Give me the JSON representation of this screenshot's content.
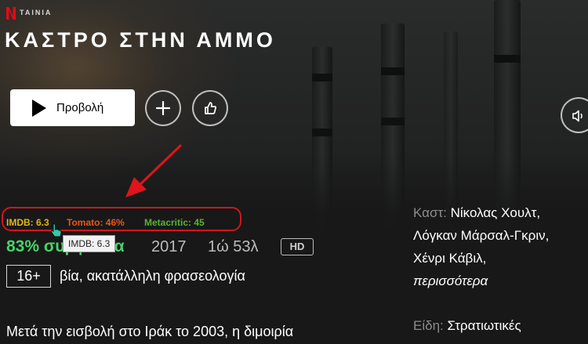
{
  "header": {
    "type_label": "ΤΑΙΝΙΑ",
    "title": "ΚΑΣΤΡΟ ΣΤΗΝ ΑΜΜΟ"
  },
  "actions": {
    "play_label": "Προβολή"
  },
  "ratings": {
    "imdb": "IMDB: 6.3",
    "tomato": "Tomato: 46%",
    "metacritic": "Metacritic: 45",
    "tooltip": "IMDB: 6.3"
  },
  "info": {
    "match": "83% συμφωνία",
    "year": "2017",
    "duration": "1ώ 53λ",
    "quality": "HD",
    "age": "16+",
    "advisory": "βία, ακατάλληλη φρασεολογία",
    "synopsis": "Μετά την εισβολή στο Ιράκ το 2003, η διμοιρία"
  },
  "details": {
    "cast_label": "Καστ:",
    "cast_line1": "Νίκολας Χουλτ,",
    "cast_line2": "Λόγκαν Μάρσαλ-Γκριν,",
    "cast_line3": "Χένρι Κάβιλ,",
    "cast_more": "περισσότερα",
    "genres_label": "Είδη:",
    "genres_line1": "Στρατιωτικές"
  },
  "colors": {
    "netflix_red": "#e50914",
    "annotation_red": "#e0141b",
    "imdb": "#e2b616",
    "tomato": "#e8561b",
    "metacritic": "#59b333",
    "match_green": "#46d369"
  },
  "icons": [
    "netflix-logo-icon",
    "play-icon",
    "plus-icon",
    "thumbs-up-icon",
    "volume-icon",
    "red-arrow-annotation",
    "cursor-hand-icon"
  ]
}
